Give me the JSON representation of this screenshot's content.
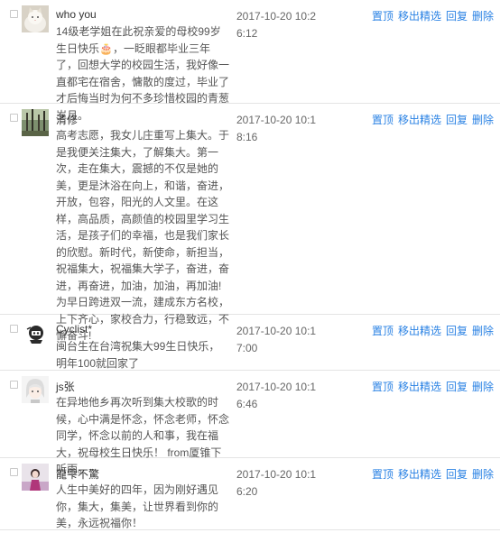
{
  "actions": {
    "top": "置顶",
    "unfeature": "移出精选",
    "reply": "回复",
    "delete": "删除"
  },
  "comments": [
    {
      "author": "who you",
      "text": "14级老学姐在此祝亲爱的母校99岁生日快乐🎂，一眨眼都毕业三年了，回想大学的校园生活，我好像一直都宅在宿舍，慵散的度过，毕业了才后悔当时为何不多珍惜校园的青葱岁月。",
      "time": "2017-10-20 10:26:12",
      "avatar_icon": "cat-avatar-icon"
    },
    {
      "author": "清修",
      "text": "高考志愿，我女儿庄重写上集大。于是我便关注集大，了解集大。第一次，走在集大，震撼的不仅是她的美，更是沐浴在向上，和谐，奋进，开放，包容，阳光的人文里。在这样，高品质，高颜值的校园里学习生活，是孩子们的幸福，也是我们家长的欣慰。新时代，新使命，新担当，祝福集大，祝福集大学子，奋进，奋进，再奋进，加油，加油，再加油! 为早日跨进双一流，建成东方名校，上下齐心，家校合力，行稳致远，不懈奋斗!",
      "time": "2017-10-20 10:18:16",
      "avatar_icon": "forest-avatar-icon"
    },
    {
      "author": "Cyclist*",
      "text": "闽台生在台湾祝集大99生日快乐，明年100就回家了",
      "time": "2017-10-20 10:17:00",
      "avatar_icon": "cyclist-avatar-icon"
    },
    {
      "author": "js张",
      "text": "在异地他乡再次听到集大校歌的时候，心中满是怀念，怀念老师，怀念同学，怀念以前的人和事，我在福大，祝母校生日快乐！ from厦锥下听雨。",
      "time": "2017-10-20 10:16:46",
      "avatar_icon": "anime-avatar-icon"
    },
    {
      "author": "龍雫不驚",
      "text": "人生中美好的四年，因为刚好遇见你，集大，集美，让世界看到你的美，永远祝福你！",
      "time": "2017-10-20 10:16:20",
      "avatar_icon": "girl-avatar-icon"
    }
  ]
}
